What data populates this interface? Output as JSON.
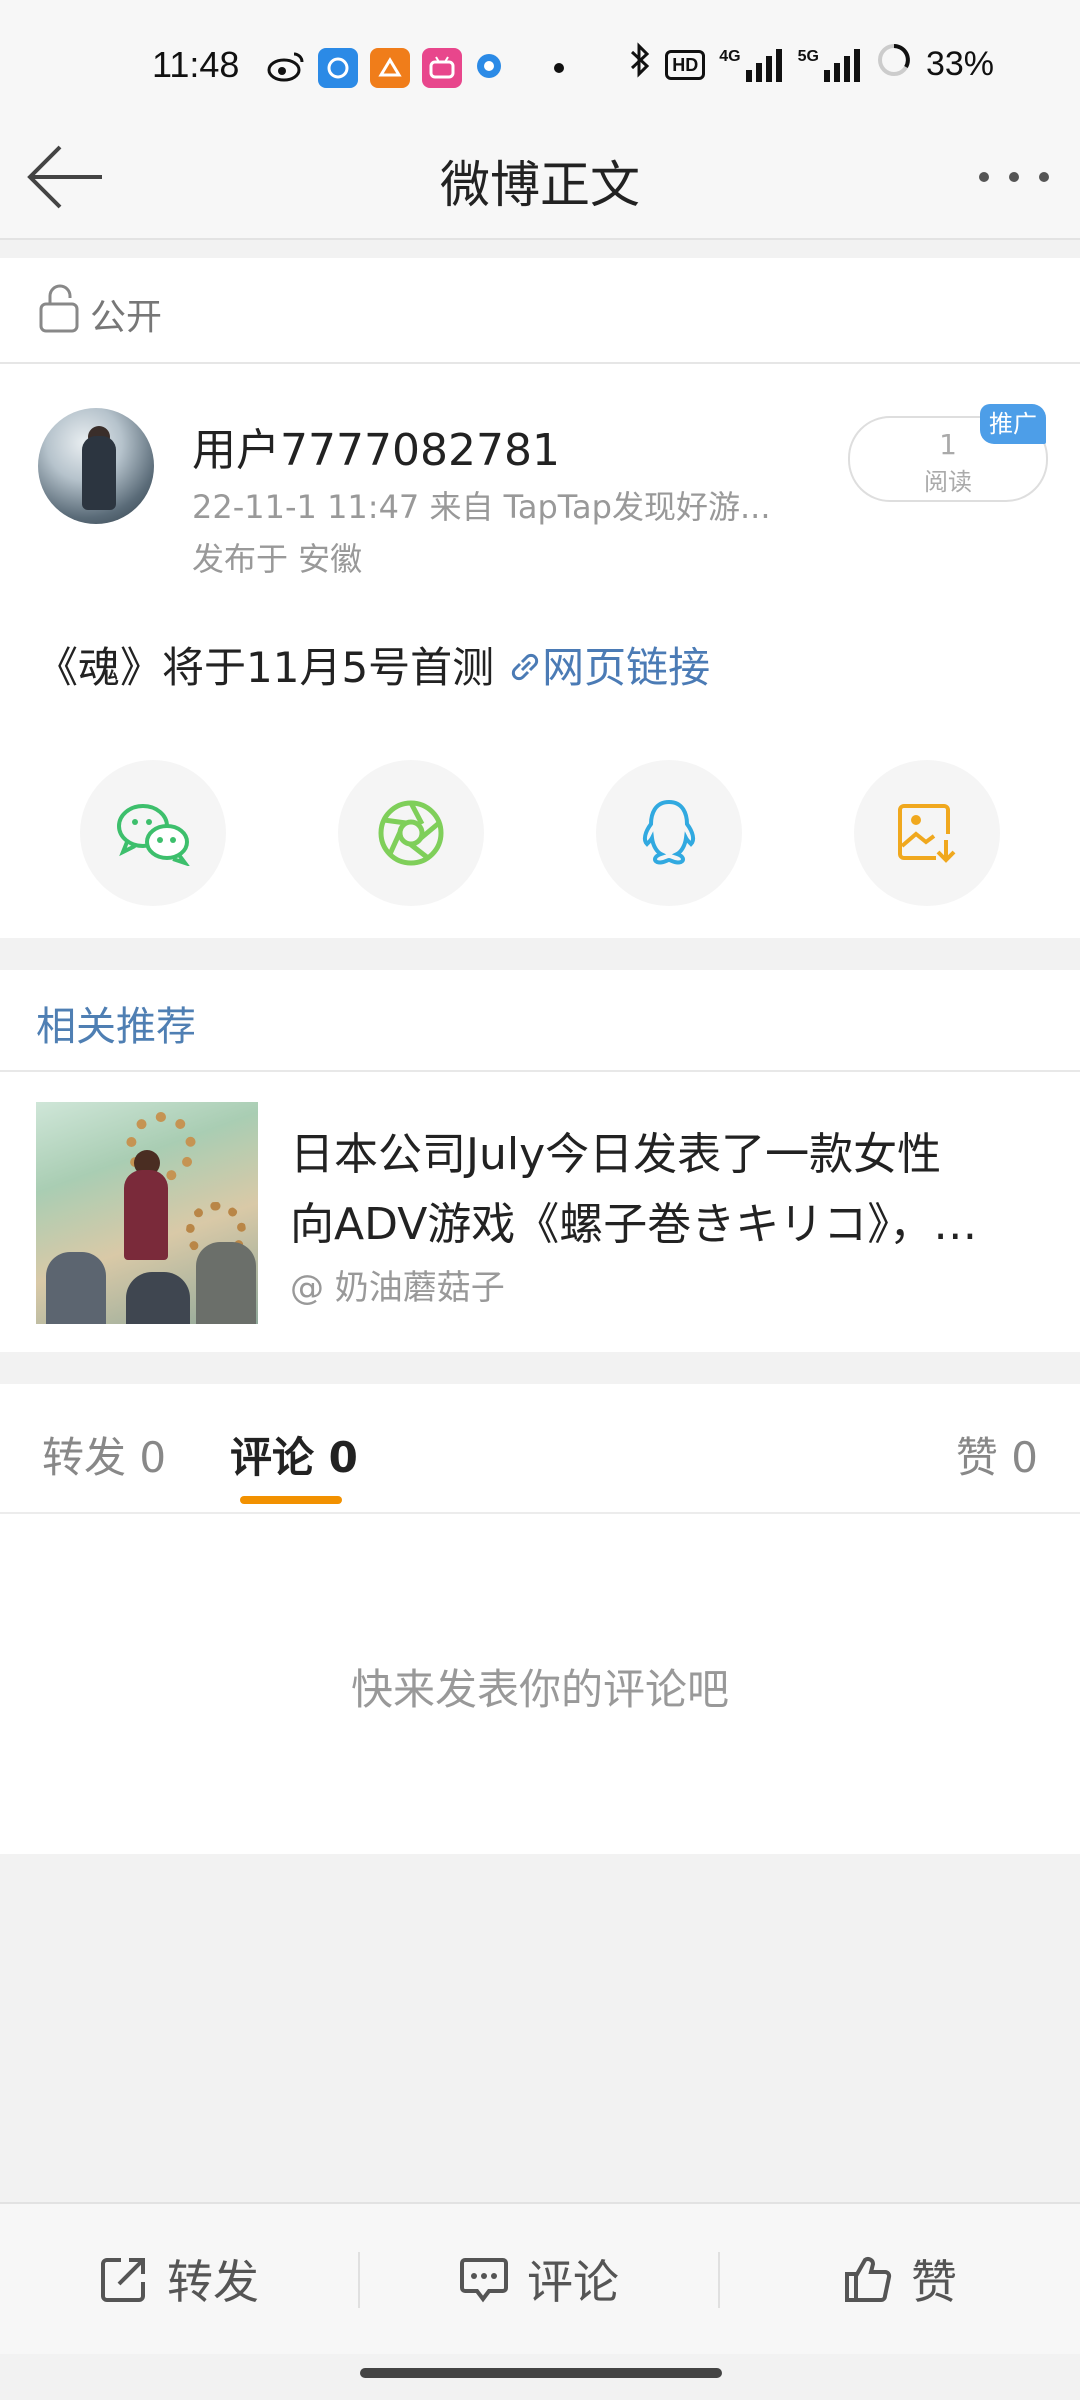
{
  "status_bar": {
    "time": "11:48",
    "hd": "HD",
    "net1": "4G",
    "net2": "5G",
    "battery": "33%",
    "icons": [
      "weibo-icon",
      "app-icon-1",
      "app-icon-2",
      "bilibili-icon",
      "circle-app-icon",
      "bluetooth-icon",
      "signal-icon",
      "battery-icon"
    ]
  },
  "header": {
    "title": "微博正文"
  },
  "visibility": {
    "label": "公开"
  },
  "post": {
    "username": "用户7777082781",
    "meta": "22-11-1 11:47   来自 TapTap发现好游...",
    "location": "发布于 安徽",
    "read_count": "1",
    "read_label": "阅读",
    "promo_tag": "推广",
    "text": "《魂》将于11月5号首测",
    "link_text": "网页链接",
    "share_buttons": [
      "wechat-icon",
      "moments-icon",
      "qq-icon",
      "save-image-icon"
    ]
  },
  "related": {
    "section_title": "相关推荐",
    "item": {
      "title_line1": "日本公司July今日发表了一款女性",
      "title_line2": "向ADV游戏《螺子巻きキリコ》，…",
      "author": "@ 奶油蘑菇子"
    }
  },
  "tabs": {
    "repost": "转发 0",
    "comment": "评论 0",
    "like": "赞 0",
    "active": "comment"
  },
  "comments": {
    "empty_hint": "快来发表你的评论吧"
  },
  "toolbar": {
    "repost_label": "转发",
    "comment_label": "评论",
    "like_label": "赞"
  },
  "colors": {
    "accent_orange": "#f29100",
    "link_blue": "#4b7bb5",
    "promo_blue": "#4d9ee8",
    "wechat_green": "#3dbf6c",
    "moments_green": "#7fcf5a",
    "qq_blue": "#31a9e0",
    "save_orange": "#f0a81e"
  }
}
